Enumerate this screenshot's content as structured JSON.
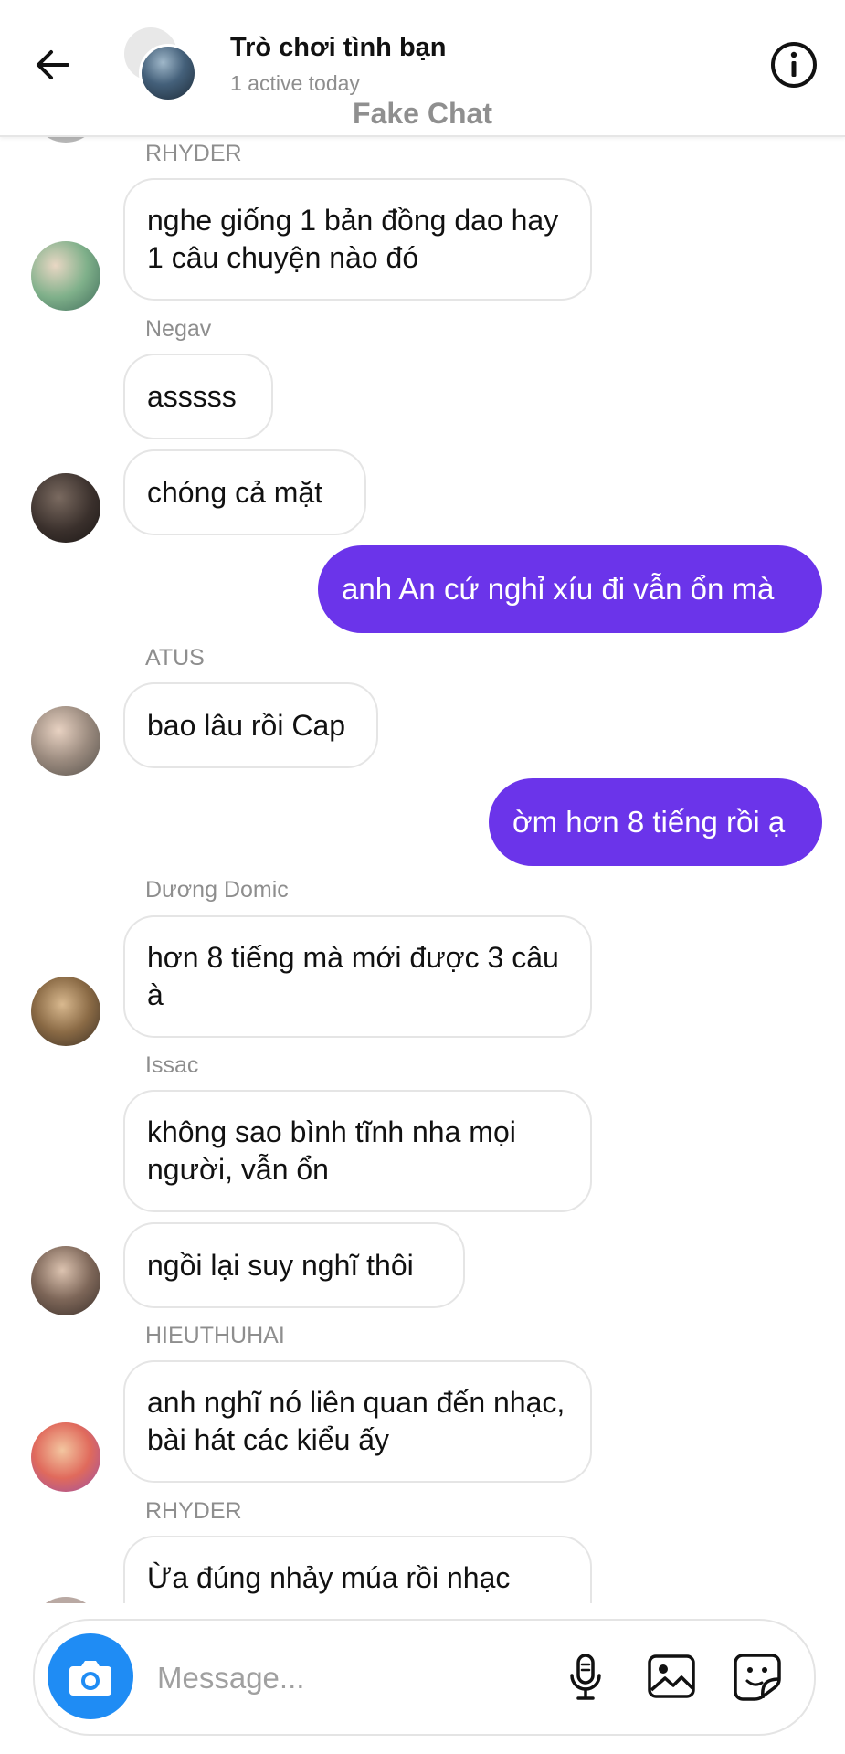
{
  "header": {
    "title": "Trò chơi tình bạn",
    "subtitle": "1 active today",
    "watermark": "Fake Chat"
  },
  "messages": [
    {
      "sender": "RHYDER",
      "text": "nghe giống 1 bản đồng dao hay 1 câu chuyện nào đó"
    },
    {
      "sender": "Negav",
      "text": "asssss"
    },
    {
      "text": "chóng cả mặt"
    },
    {
      "outgoing": true,
      "text": "anh An cứ nghỉ xíu đi vẫn ổn mà"
    },
    {
      "sender": "ATUS",
      "text": "bao lâu rồi Cap"
    },
    {
      "outgoing": true,
      "text": "ờm hơn 8 tiếng rồi ạ"
    },
    {
      "sender": "Dương Domic",
      "text": "hơn 8 tiếng mà mới được 3 câu à"
    },
    {
      "sender": "Issac",
      "text": "không sao bình tĩnh nha mọi người, vẫn ổn"
    },
    {
      "text": "ngồi lại suy nghĩ thôi"
    },
    {
      "sender": "HIEUTHUHAI",
      "text": "anh nghĩ nó liên quan đến nhạc, bài hát các kiểu ấy"
    },
    {
      "sender": "RHYDER",
      "text": "Ừa đúng nhảy múa rồi nhạc"
    }
  ],
  "composer": {
    "placeholder": "Message..."
  },
  "colors": {
    "outgoing_bubble": "#6b34ea",
    "camera_button": "#1f8cf4"
  },
  "icons": [
    "back-arrow-icon",
    "info-icon",
    "camera-icon",
    "microphone-icon",
    "gallery-icon",
    "sticker-icon"
  ]
}
